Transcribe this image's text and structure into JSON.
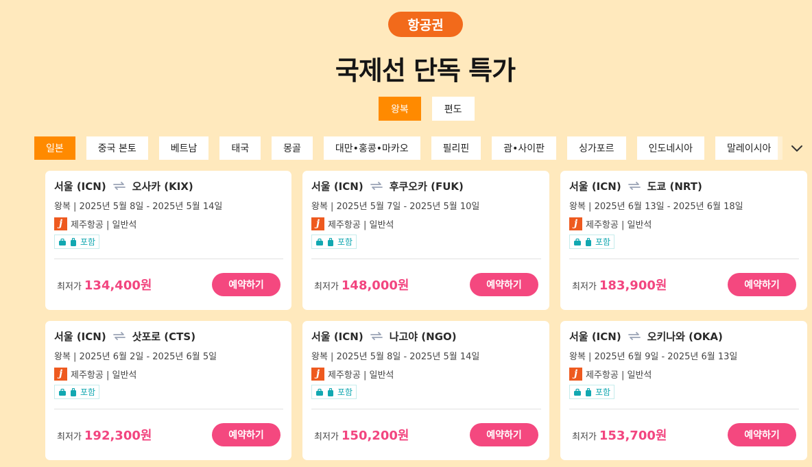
{
  "header": {
    "badge": "항공권",
    "title": "국제선 단독 특가"
  },
  "trip_types": [
    {
      "label": "왕복",
      "active": true
    },
    {
      "label": "편도",
      "active": false
    }
  ],
  "regions": [
    {
      "label": "일본",
      "active": true
    },
    {
      "label": "중국 본토",
      "active": false
    },
    {
      "label": "베트남",
      "active": false
    },
    {
      "label": "태국",
      "active": false
    },
    {
      "label": "몽골",
      "active": false
    },
    {
      "label": "대만•홍콩•마카오",
      "active": false
    },
    {
      "label": "필리핀",
      "active": false
    },
    {
      "label": "괌•사이판",
      "active": false
    },
    {
      "label": "싱가포르",
      "active": false
    },
    {
      "label": "인도네시아",
      "active": false
    },
    {
      "label": "말레이시아",
      "active": false
    }
  ],
  "region_toggle_icon": "chevron-down-icon",
  "colors": {
    "background": "#ffe9bd",
    "accent_orange": "#ff8a00",
    "badge_orange": "#f26a1b",
    "price_pink": "#f2457f",
    "button_pink": "#f4487f",
    "baggage_teal": "#11a8b1"
  },
  "deals": [
    {
      "origin": "서울 (ICN)",
      "destination": "오사카 (KIX)",
      "dates": "왕복 | 2025년 5월 8일 - 2025년 5월 14일",
      "airline": "제주항공 | 일반석",
      "airline_logo": "j",
      "baggage": "포함",
      "price_label": "최저가",
      "price": "134,400원",
      "book_label": "예약하기"
    },
    {
      "origin": "서울 (ICN)",
      "destination": "후쿠오카 (FUK)",
      "dates": "왕복 | 2025년 5월 7일 - 2025년 5월 10일",
      "airline": "제주항공 | 일반석",
      "airline_logo": "j",
      "baggage": "포함",
      "price_label": "최저가",
      "price": "148,000원",
      "book_label": "예약하기"
    },
    {
      "origin": "서울 (ICN)",
      "destination": "도쿄 (NRT)",
      "dates": "왕복 | 2025년 6월 13일 - 2025년 6월 18일",
      "airline": "제주항공 | 일반석",
      "airline_logo": "j",
      "baggage": "포함",
      "price_label": "최저가",
      "price": "183,900원",
      "book_label": "예약하기"
    },
    {
      "origin": "서울 (ICN)",
      "destination": "삿포로 (CTS)",
      "dates": "왕복 | 2025년 6월 2일 - 2025년 6월 5일",
      "airline": "제주항공 | 일반석",
      "airline_logo": "j",
      "baggage": "포함",
      "price_label": "최저가",
      "price": "192,300원",
      "book_label": "예약하기"
    },
    {
      "origin": "서울 (ICN)",
      "destination": "나고야 (NGO)",
      "dates": "왕복 | 2025년 5월 8일 - 2025년 5월 14일",
      "airline": "제주항공 | 일반석",
      "airline_logo": "j",
      "baggage": "포함",
      "price_label": "최저가",
      "price": "150,200원",
      "book_label": "예약하기"
    },
    {
      "origin": "서울 (ICN)",
      "destination": "오키나와 (OKA)",
      "dates": "왕복 | 2025년 6월 9일 - 2025년 6월 13일",
      "airline": "제주항공 | 일반석",
      "airline_logo": "j",
      "baggage": "포함",
      "price_label": "최저가",
      "price": "153,700원",
      "book_label": "예약하기"
    }
  ]
}
